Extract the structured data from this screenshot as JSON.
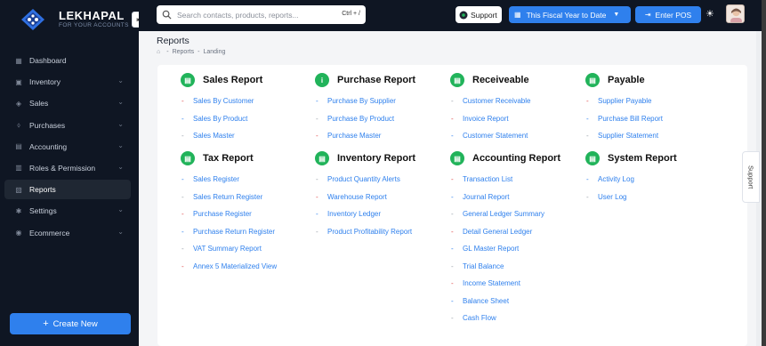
{
  "brand": {
    "name": "LEKHAPAL",
    "tagline": "FOR YOUR ACCOUNTS"
  },
  "sidebar": {
    "items": [
      {
        "label": "Dashboard",
        "icon": "grid-icon",
        "chevron": false,
        "active": false
      },
      {
        "label": "Inventory",
        "icon": "box-icon",
        "chevron": true,
        "active": false
      },
      {
        "label": "Sales",
        "icon": "tag-icon",
        "chevron": true,
        "active": false
      },
      {
        "label": "Purchases",
        "icon": "cart-icon",
        "chevron": true,
        "active": false
      },
      {
        "label": "Accounting",
        "icon": "ledger-icon",
        "chevron": true,
        "active": false
      },
      {
        "label": "Roles & Permission",
        "icon": "shield-icon",
        "chevron": true,
        "active": false
      },
      {
        "label": "Reports",
        "icon": "chart-icon",
        "chevron": false,
        "active": true
      },
      {
        "label": "Settings",
        "icon": "gear-icon",
        "chevron": true,
        "active": false
      },
      {
        "label": "Ecommerce",
        "icon": "store-icon",
        "chevron": true,
        "active": false
      }
    ],
    "create_label": "Create New"
  },
  "topbar": {
    "search_placeholder": "Search contacts, products, reports...",
    "search_shortcut": "Ctrl + /",
    "support_label": "Support",
    "fiscal_label": "This Fiscal Year to Date",
    "pos_label": "Enter POS"
  },
  "page": {
    "title": "Reports",
    "breadcrumb": [
      "Reports",
      "Landing"
    ]
  },
  "sections": [
    {
      "title": "Sales Report",
      "links": [
        "Sales By Customer",
        "Sales By Product",
        "Sales Master"
      ]
    },
    {
      "title": "Purchase Report",
      "links": [
        "Purchase By Supplier",
        "Purchase By Product",
        "Purchase Master"
      ]
    },
    {
      "title": "Receiveable",
      "links": [
        "Customer Receivable",
        "Invoice Report",
        "Customer Statement"
      ]
    },
    {
      "title": "Payable",
      "links": [
        "Supplier Payable",
        "Purchase Bill Report",
        "Supplier Statement"
      ]
    },
    {
      "title": "Tax Report",
      "links": [
        "Sales Register",
        "Sales Return Register",
        "Purchase Register",
        "Purchase Return Register",
        "VAT Summary Report",
        "Annex 5 Materialized View"
      ]
    },
    {
      "title": "Inventory Report",
      "links": [
        "Product Quantity Alerts",
        "Warehouse Report",
        "Inventory Ledger",
        "Product Profitability Report"
      ]
    },
    {
      "title": "Accounting Report",
      "links": [
        "Transaction List",
        "Journal Report",
        "General Ledger Summary",
        "Detail General Ledger",
        "GL Master Report",
        "Trial Balance",
        "Income Statement",
        "Balance Sheet",
        "Cash Flow"
      ]
    },
    {
      "title": "System Report",
      "links": [
        "Activity Log",
        "User Log"
      ]
    }
  ],
  "support_tab": "Support",
  "colors": {
    "accent": "#2f80ed",
    "sidebar": "#0f1623",
    "section_icon": "#21b35a"
  }
}
